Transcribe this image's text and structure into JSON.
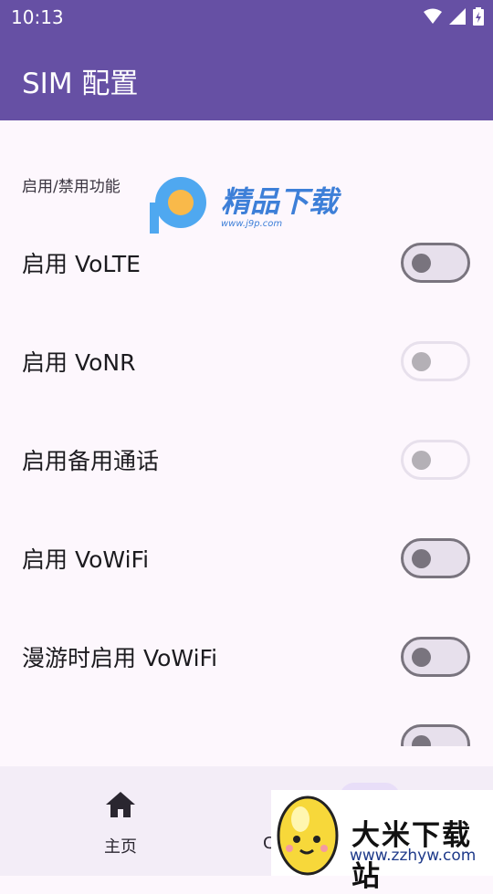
{
  "status_bar": {
    "time": "10:13"
  },
  "app_bar": {
    "title": "SIM 配置"
  },
  "section": {
    "header": "启用/禁用功能"
  },
  "settings": [
    {
      "label": "启用 VoLTE",
      "enabled": false,
      "disabled": false
    },
    {
      "label": "启用 VoNR",
      "enabled": false,
      "disabled": true
    },
    {
      "label": "启用备用通话",
      "enabled": false,
      "disabled": true
    },
    {
      "label": "启用 VoWiFi",
      "enabled": false,
      "disabled": false
    },
    {
      "label": "漫游时启用 VoWiFi",
      "enabled": false,
      "disabled": false
    }
  ],
  "bottom_nav": {
    "home_label": "主页",
    "second_label": "C"
  },
  "watermarks": {
    "top_brand": "精品下载",
    "top_url": "www.j9p.com",
    "bottom_brand": "大米下载站",
    "bottom_url": "www.zzhyw.com"
  },
  "colors": {
    "primary": "#6650a4",
    "background": "#fdf7fd",
    "switch_track": "#e7e0ec",
    "switch_outline": "#79747e",
    "nav_background": "#f3edf7"
  }
}
